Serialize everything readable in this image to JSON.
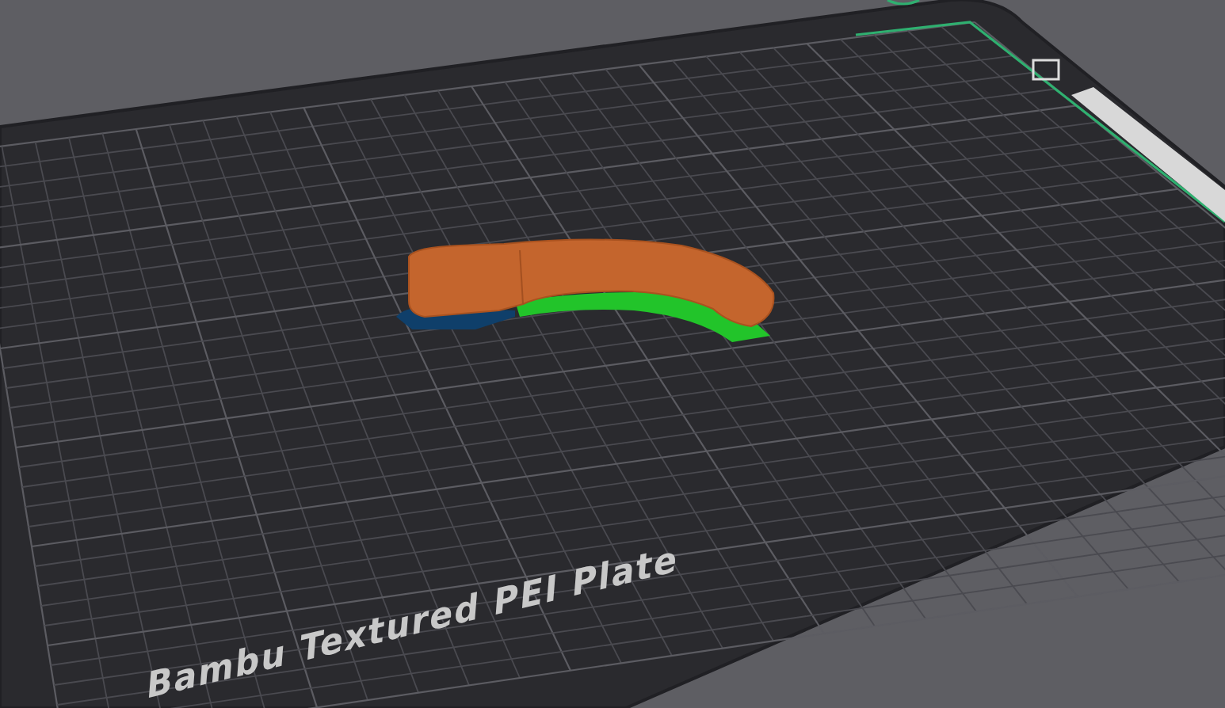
{
  "viewport": {
    "plate_label": "Bambu Textured PEI Plate"
  }
}
